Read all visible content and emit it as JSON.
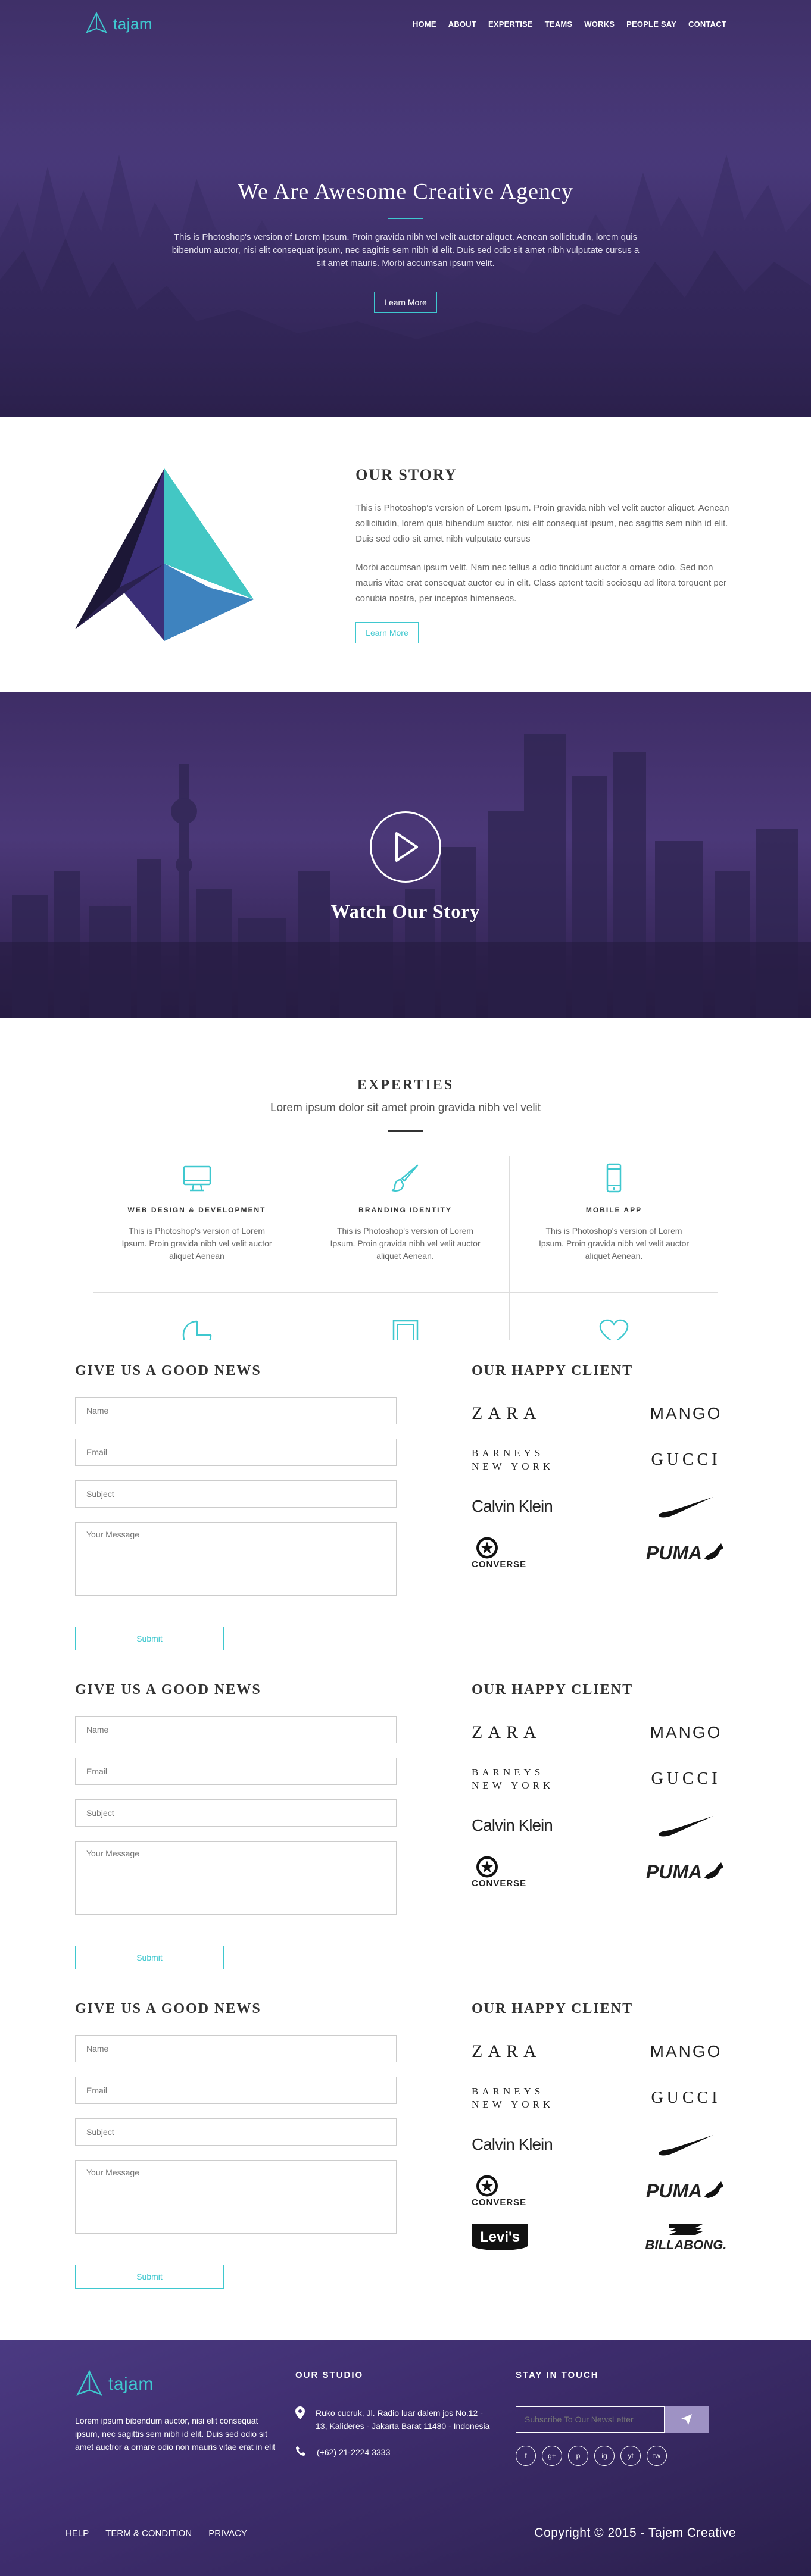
{
  "brand": {
    "name": "tajam",
    "accent": "#3fc8cf",
    "purple": "#4a3a7c"
  },
  "nav": {
    "items": [
      "HOME",
      "ABOUT",
      "EXPERTISE",
      "TEAMS",
      "WORKS",
      "PEOPLE SAY",
      "CONTACT"
    ]
  },
  "hero": {
    "title": "We Are Awesome Creative Agency",
    "text": "This is Photoshop's version of Lorem Ipsum. Proin gravida nibh vel velit auctor aliquet. Aenean sollicitudin, lorem quis bibendum auctor, nisi elit consequat ipsum, nec sagittis sem nibh id elit. Duis sed odio sit amet nibh vulputate cursus a sit amet mauris. Morbi accumsan ipsum velit.",
    "button": "Learn More"
  },
  "story": {
    "title": "OUR STORY",
    "p1": "This is Photoshop's version of Lorem Ipsum. Proin gravida nibh vel velit auctor aliquet. Aenean sollicitudin, lorem quis bibendum auctor, nisi elit consequat ipsum, nec sagittis sem nibh id elit. Duis sed odio sit amet nibh vulputate cursus",
    "p2": "Morbi accumsan ipsum velit. Nam nec tellus a odio tincidunt auctor a ornare odio. Sed non mauris vitae erat consequat auctor eu in elit. Class aptent taciti sociosqu ad litora torquent per conubia nostra, per inceptos himenaeos.",
    "button": "Learn More"
  },
  "video": {
    "title": "Watch Our Story"
  },
  "experties": {
    "title": "EXPERTIES",
    "subtitle": "Lorem ipsum dolor sit amet proin gravida nibh vel velit",
    "items": [
      {
        "icon": "monitor-icon",
        "title": "WEB DESIGN & DEVELOPMENT",
        "text": "This is Photoshop's version of Lorem Ipsum. Proin gravida nibh vel velit auctor aliquet Aenean"
      },
      {
        "icon": "brush-icon",
        "title": "BRANDING IDENTITY",
        "text": "This is Photoshop's version of Lorem Ipsum. Proin gravida nibh vel velit auctor aliquet Aenean."
      },
      {
        "icon": "mobile-icon",
        "title": "MOBILE APP",
        "text": "This is Photoshop's version of Lorem Ipsum. Proin gravida nibh vel velit auctor aliquet Aenean."
      }
    ],
    "row2_icons": [
      "pie-chart-icon",
      "frame-icon",
      "heart-icon"
    ]
  },
  "contact": {
    "title": "GIVE US A GOOD NEWS",
    "name_placeholder": "Name",
    "email_placeholder": "Email",
    "subject_placeholder": "Subject",
    "message_placeholder": "Your Message",
    "submit": "Submit"
  },
  "clients": {
    "title": "OUR HAPPY CLIENT",
    "logos": [
      "ZARA",
      "MANGO",
      "BARNEYS NEW YORK",
      "GUCCI",
      "Calvin Klein",
      "Nike",
      "CONVERSE",
      "PUMA",
      "Levi's",
      "BILLABONG."
    ]
  },
  "footer": {
    "about": "Lorem ipsum bibendum auctor, nisi elit consequat ipsum, nec sagittis sem nibh id elit. Duis sed odio sit amet auctror a ornare odio non mauris vitae erat in elit",
    "studio_title": "OUR STUDIO",
    "address": "Ruko cucruk, Jl. Radio luar dalem jos No.12 - 13, Kalideres - Jakarta Barat 11480 - Indonesia",
    "phone": "(+62) 21-2224 3333",
    "touch_title": "STAY IN TOUCH",
    "newsletter_placeholder": "Subscribe To Our NewsLetter",
    "socials": [
      "f",
      "g+",
      "p",
      "ig",
      "yt",
      "tw"
    ],
    "links": [
      "HELP",
      "TERM & CONDITION",
      "PRIVACY"
    ],
    "copyright": "Copyright © 2015 - Tajem Creative"
  }
}
